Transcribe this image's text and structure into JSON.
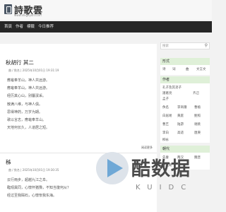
{
  "header": {
    "logo_icon": "book-icon",
    "logo_title": "詩歌雲",
    "logo_subtitle": "www.shigeyun.com"
  },
  "nav": {
    "items": [
      "首頁",
      "作者",
      "標籤",
      "今日推荐"
    ]
  },
  "posts": [
    {
      "title": "秋胡行 其二",
      "meta": "曲 / 佚名 | 2025年10月01日 19:31:19",
      "lines": [
        "應龜奉羊山，神人共远游。",
        "應龜奉羊山，神人共远游。",
        "经历其心山，别屬潔采。",
        "散满八维，与神人俱。",
        "思得神药，万岁为期。",
        "歌以言志，應龜奉羊山。",
        "天地何长久，人道居之短。"
      ],
      "read_more": "阅读更多"
    },
    {
      "title": "秭",
      "meta": "曲 / 佚名 | 2025年10月01日 19:30:35",
      "lines": [
        "云行雨步，超越九江之阜。",
        "臨观異同，心懷怀猶豫，不知当復何从？",
        "经过至我碣石，心懷怅我东海。"
      ]
    }
  ],
  "sidebar": {
    "search_placeholder": "搜索",
    "search_icon": "search-icon",
    "widgets": [
      {
        "title": "形式",
        "tags": [
          "诗",
          "词",
          "曲",
          "文言文"
        ]
      },
      {
        "title": "作者",
        "tags": [
          "孔子及其弟子",
          "諸葛亮",
          "齐己",
          "孟子",
          "佚名",
          "李商隱",
          "曹植",
          "白居易",
          "黄庭",
          "鲍照",
          "曹丕",
          "陆游",
          "谢朓",
          "李白",
          "高适",
          "唐庚",
          "柳永"
        ]
      },
      {
        "title": "朝代",
        "tags": [
          "先秦",
          "两汉",
          "魏晋",
          "南北朝"
        ]
      }
    ]
  },
  "watermark": {
    "text": "酷数据",
    "subtext": "KUIDC"
  }
}
